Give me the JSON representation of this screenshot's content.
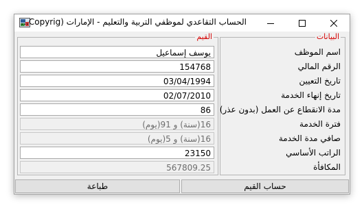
{
  "window": {
    "title": "الحساب التقاعدي لموظفي التربية والتعليم - الإمارات (Copyrig..."
  },
  "groups": {
    "labels_title": "البيانات",
    "values_title": "القيم"
  },
  "fields": [
    {
      "label": "اسم الموظف",
      "value": "يوسف إسماعيل"
    },
    {
      "label": "الرقم المالي",
      "value": "154768"
    },
    {
      "label": "تاريخ التعيين",
      "value": "03/04/1994"
    },
    {
      "label": "تاريخ إنهاء الخدمة",
      "value": "02/07/2010"
    },
    {
      "label": "مدة الانقطاع عن العمل (بدون عذر)",
      "value": "86"
    },
    {
      "label": "فترة الخدمة",
      "value": "16(سنة) و 91(يوم)"
    },
    {
      "label": "صافي مدة الخدمة",
      "value": "16(سنة) و 5(يوم)"
    },
    {
      "label": "الراتب الأساسي",
      "value": "23150"
    },
    {
      "label": "المكافأة",
      "value": "567809.25"
    }
  ],
  "buttons": {
    "calculate": "حساب القيم",
    "print": "طباعة"
  }
}
